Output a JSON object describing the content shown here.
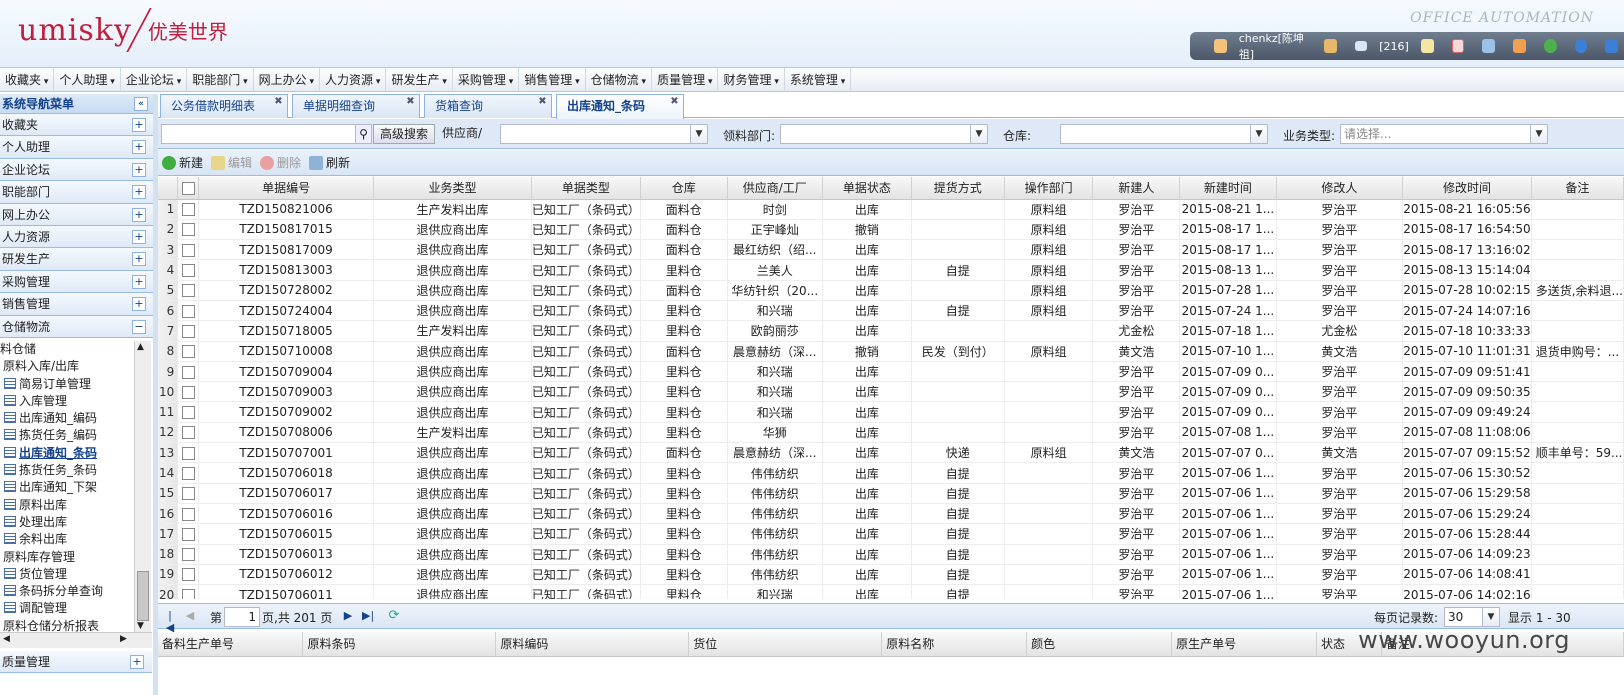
{
  "header": {
    "logo_en": "umisky",
    "logo_cn": "优美世界",
    "product": "OFFICE AUTOMATION",
    "user": "chenkz[陈坤祖]",
    "mail_count": "[216]",
    "icons": [
      "user-icon",
      "contacts-icon",
      "mail-icon",
      "note-icon",
      "calendar-icon",
      "group-icon",
      "home-icon",
      "refresh-icon",
      "help-icon",
      "collapse-icon"
    ]
  },
  "menubar": [
    "收藏夹",
    "个人助理",
    "企业论坛",
    "职能部门",
    "网上办公",
    "人力资源",
    "研发生产",
    "采购管理",
    "销售管理",
    "仓储物流",
    "质量管理",
    "财务管理",
    "系统管理"
  ],
  "sidebar": {
    "title": "系统导航菜单",
    "sections": [
      "收藏夹",
      "个人助理",
      "企业论坛",
      "职能部门",
      "网上办公",
      "人力资源",
      "研发生产",
      "采购管理",
      "销售管理",
      "仓储物流"
    ],
    "expanded_section": "仓储物流",
    "tree": [
      {
        "label": "料仓储",
        "level": 0,
        "icon": false
      },
      {
        "label": "原料入库/出库",
        "level": 0,
        "icon": false
      },
      {
        "label": "简易订单管理",
        "level": 1,
        "icon": true
      },
      {
        "label": "入库管理",
        "level": 1,
        "icon": true
      },
      {
        "label": "出库通知_编码",
        "level": 1,
        "icon": true
      },
      {
        "label": "拣货任务_编码",
        "level": 1,
        "icon": true
      },
      {
        "label": "出库通知_条码",
        "level": 1,
        "icon": true,
        "selected": true
      },
      {
        "label": "拣货任务_条码",
        "level": 1,
        "icon": true
      },
      {
        "label": "出库通知_下架",
        "level": 1,
        "icon": true
      },
      {
        "label": "原料出库",
        "level": 1,
        "icon": true
      },
      {
        "label": "处理出库",
        "level": 1,
        "icon": true
      },
      {
        "label": "余料出库",
        "level": 1,
        "icon": true
      },
      {
        "label": "原料库存管理",
        "level": 0,
        "icon": false
      },
      {
        "label": "货位管理",
        "level": 1,
        "icon": true
      },
      {
        "label": "条码拆分单查询",
        "level": 1,
        "icon": true
      },
      {
        "label": "调配管理",
        "level": 1,
        "icon": true
      },
      {
        "label": "原料仓储分析报表",
        "level": 0,
        "icon": false
      }
    ],
    "bottom_section": "质量管理"
  },
  "tabs": [
    {
      "label": "公务借款明细表",
      "active": false
    },
    {
      "label": "单据明细查询",
      "active": false
    },
    {
      "label": "货箱查询",
      "active": false
    },
    {
      "label": "出库通知_条码",
      "active": true
    }
  ],
  "search": {
    "advanced_button": "高级搜索",
    "supplier_label": "供应商/工厂:",
    "dept_label": "领料部门:",
    "warehouse_label": "仓库:",
    "biztype_label": "业务类型:",
    "biztype_placeholder": "请选择..."
  },
  "toolbar": {
    "new": "新建",
    "edit": "编辑",
    "delete": "删除",
    "refresh": "刷新"
  },
  "grid": {
    "columns": [
      "单据编号",
      "业务类型",
      "单据类型",
      "仓库",
      "供应商/工厂",
      "单据状态",
      "提货方式",
      "操作部门",
      "新建人",
      "新建时间",
      "修改人",
      "修改时间",
      "备注"
    ],
    "rows": [
      [
        "1",
        "TZD150821006",
        "生产发料出库",
        "已知工厂（条码式）",
        "面料仓",
        "时剑",
        "出库",
        "",
        "原料组",
        "罗治平",
        "2015-08-21 1...",
        "罗治平",
        "2015-08-21 16:05:56",
        ""
      ],
      [
        "2",
        "TZD150817015",
        "退供应商出库",
        "已知工厂（条码式）",
        "面料仓",
        "正宇峰灿",
        "撤销",
        "",
        "原料组",
        "罗治平",
        "2015-08-17 1...",
        "罗治平",
        "2015-08-17 16:54:50",
        ""
      ],
      [
        "3",
        "TZD150817009",
        "退供应商出库",
        "已知工厂（条码式）",
        "面料仓",
        "最红纺织（绍...",
        "出库",
        "",
        "原料组",
        "罗治平",
        "2015-08-17 1...",
        "罗治平",
        "2015-08-17 13:16:02",
        ""
      ],
      [
        "4",
        "TZD150813003",
        "退供应商出库",
        "已知工厂（条码式）",
        "里料仓",
        "兰美人",
        "出库",
        "自提",
        "原料组",
        "罗治平",
        "2015-08-13 1...",
        "罗治平",
        "2015-08-13 15:14:04",
        ""
      ],
      [
        "5",
        "TZD150728002",
        "退供应商出库",
        "已知工厂（条码式）",
        "面料仓",
        "华纺针织（20...",
        "出库",
        "",
        "原料组",
        "罗治平",
        "2015-07-28 1...",
        "罗治平",
        "2015-07-28 10:02:15",
        "多送货,余料退..."
      ],
      [
        "6",
        "TZD150724004",
        "退供应商出库",
        "已知工厂（条码式）",
        "里料仓",
        "和兴瑞",
        "出库",
        "自提",
        "原料组",
        "罗治平",
        "2015-07-24 1...",
        "罗治平",
        "2015-07-24 14:07:16",
        ""
      ],
      [
        "7",
        "TZD150718005",
        "生产发料出库",
        "已知工厂（条码式）",
        "里料仓",
        "欧韵丽莎",
        "出库",
        "",
        "",
        "尤金松",
        "2015-07-18 1...",
        "尤金松",
        "2015-07-18 10:33:33",
        ""
      ],
      [
        "8",
        "TZD150710008",
        "退供应商出库",
        "已知工厂（条码式）",
        "面料仓",
        "晨意赫纺（深...",
        "撤销",
        "民发（到付）",
        "原料组",
        "黄文浩",
        "2015-07-10 1...",
        "黄文浩",
        "2015-07-10 11:01:31",
        "退货申购号：..."
      ],
      [
        "9",
        "TZD150709004",
        "退供应商出库",
        "已知工厂（条码式）",
        "里料仓",
        "和兴瑞",
        "出库",
        "",
        "",
        "罗治平",
        "2015-07-09 0...",
        "罗治平",
        "2015-07-09 09:51:41",
        ""
      ],
      [
        "10",
        "TZD150709003",
        "退供应商出库",
        "已知工厂（条码式）",
        "里料仓",
        "和兴瑞",
        "出库",
        "",
        "",
        "罗治平",
        "2015-07-09 0...",
        "罗治平",
        "2015-07-09 09:50:35",
        ""
      ],
      [
        "11",
        "TZD150709002",
        "退供应商出库",
        "已知工厂（条码式）",
        "里料仓",
        "和兴瑞",
        "出库",
        "",
        "",
        "罗治平",
        "2015-07-09 0...",
        "罗治平",
        "2015-07-09 09:49:24",
        ""
      ],
      [
        "12",
        "TZD150708006",
        "生产发料出库",
        "已知工厂（条码式）",
        "里料仓",
        "华狮",
        "出库",
        "",
        "",
        "罗治平",
        "2015-07-08 1...",
        "罗治平",
        "2015-07-08 11:08:06",
        ""
      ],
      [
        "13",
        "TZD150707001",
        "退供应商出库",
        "已知工厂（条码式）",
        "面料仓",
        "晨意赫纺（深...",
        "出库",
        "快递",
        "原料组",
        "黄文浩",
        "2015-07-07 0...",
        "黄文浩",
        "2015-07-07 09:15:52",
        "顺丰单号：59..."
      ],
      [
        "14",
        "TZD150706018",
        "退供应商出库",
        "已知工厂（条码式）",
        "里料仓",
        "伟伟纺织",
        "出库",
        "自提",
        "",
        "罗治平",
        "2015-07-06 1...",
        "罗治平",
        "2015-07-06 15:30:52",
        ""
      ],
      [
        "15",
        "TZD150706017",
        "退供应商出库",
        "已知工厂（条码式）",
        "里料仓",
        "伟伟纺织",
        "出库",
        "自提",
        "",
        "罗治平",
        "2015-07-06 1...",
        "罗治平",
        "2015-07-06 15:29:58",
        ""
      ],
      [
        "16",
        "TZD150706016",
        "退供应商出库",
        "已知工厂（条码式）",
        "里料仓",
        "伟伟纺织",
        "出库",
        "自提",
        "",
        "罗治平",
        "2015-07-06 1...",
        "罗治平",
        "2015-07-06 15:29:24",
        ""
      ],
      [
        "17",
        "TZD150706015",
        "退供应商出库",
        "已知工厂（条码式）",
        "里料仓",
        "伟伟纺织",
        "出库",
        "自提",
        "",
        "罗治平",
        "2015-07-06 1...",
        "罗治平",
        "2015-07-06 15:28:44",
        ""
      ],
      [
        "18",
        "TZD150706013",
        "退供应商出库",
        "已知工厂（条码式）",
        "里料仓",
        "伟伟纺织",
        "出库",
        "自提",
        "",
        "罗治平",
        "2015-07-06 1...",
        "罗治平",
        "2015-07-06 14:09:23",
        ""
      ],
      [
        "19",
        "TZD150706012",
        "退供应商出库",
        "已知工厂（条码式）",
        "里料仓",
        "伟伟纺织",
        "出库",
        "自提",
        "",
        "罗治平",
        "2015-07-06 1...",
        "罗治平",
        "2015-07-06 14:08:41",
        ""
      ],
      [
        "20",
        "TZD150706011",
        "退供应商出库",
        "已知工厂（条码式）",
        "里料仓",
        "和兴瑞",
        "出库",
        "自提",
        "",
        "罗治平",
        "2015-07-06 1...",
        "罗治平",
        "2015-07-06 14:02:16",
        ""
      ]
    ]
  },
  "pager": {
    "page_label": "第",
    "page_value": "1",
    "total_label": "页,共 201 页",
    "per_page_label": "每页记录数:",
    "per_page_value": "30",
    "display_label": "显示 1 - 30"
  },
  "bottom_grid": {
    "columns": [
      "备料生产单号",
      "原料条码",
      "原料编码",
      "货位",
      "原料名称",
      "颜色",
      "原生产单号",
      "状态",
      "备注"
    ]
  },
  "watermark": "www.wooyun.org",
  "colors": {
    "brand": "#c0203e",
    "accent": "#15428b",
    "panel_border": "#99bbe8",
    "userbar": "#4c5868"
  }
}
